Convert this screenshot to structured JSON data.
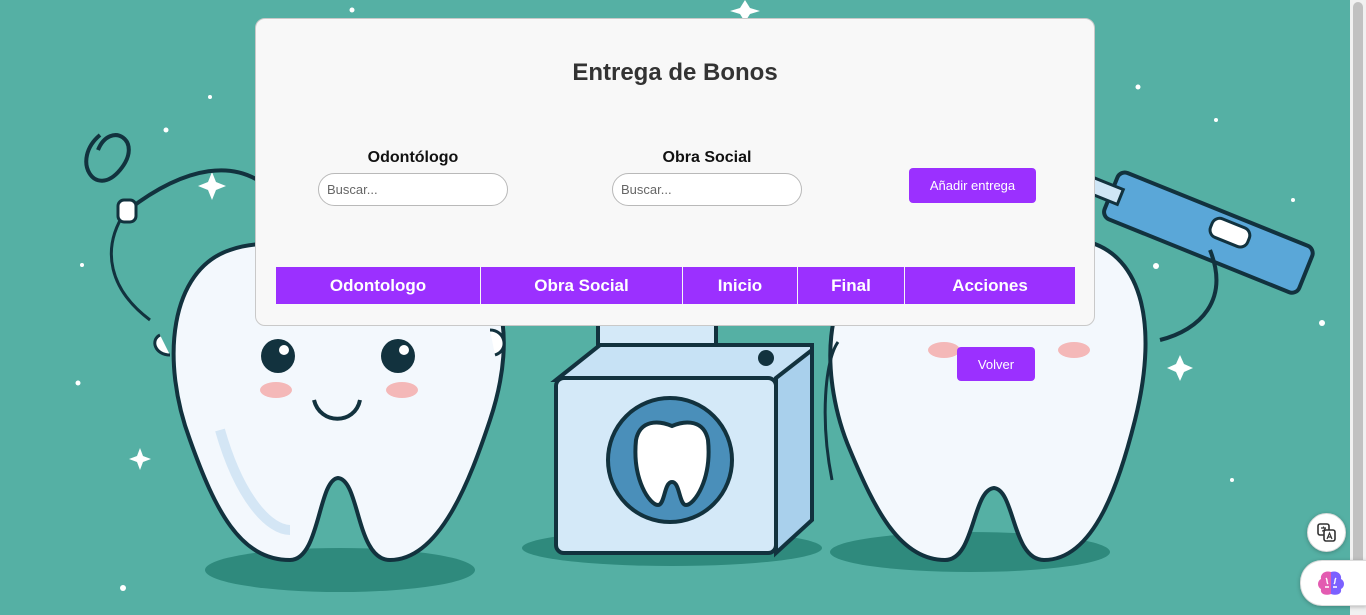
{
  "page": {
    "title": "Entrega de Bonos",
    "filters": {
      "odontologo": {
        "label": "Odontólogo",
        "placeholder": "Buscar..."
      },
      "obra_social": {
        "label": "Obra Social",
        "placeholder": "Buscar..."
      }
    },
    "add_button_label": "Añadir entrega",
    "table": {
      "columns": [
        "Odontologo",
        "Obra Social",
        "Inicio",
        "Final",
        "Acciones"
      ],
      "rows": []
    },
    "back_button_label": "Volver"
  },
  "colors": {
    "accent": "#9b30ff",
    "background": "#55b0a4",
    "card": "#f8f8f8"
  },
  "floating_buttons": [
    {
      "icon": "translate-icon"
    },
    {
      "icon": "brain-icon"
    }
  ]
}
